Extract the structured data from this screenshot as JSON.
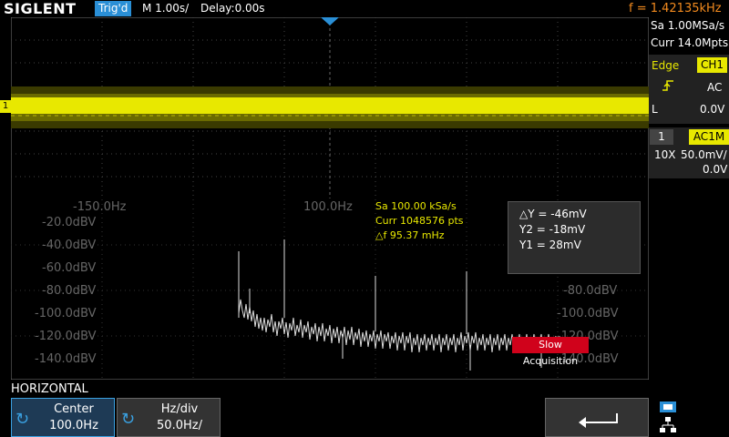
{
  "topbar": {
    "brand": "SIGLENT",
    "trigger_status": "Trig'd",
    "timebase": "M 1.00s/",
    "delay": "Delay:0.00s",
    "frequency": "f = 1.42135kHz"
  },
  "acquisition": {
    "sample_rate": "Sa 1.00MSa/s",
    "memory_depth": "Curr 14.0Mpts"
  },
  "trigger": {
    "type": "Edge",
    "source": "CH1",
    "slope_icon": "rising-edge-icon",
    "coupling": "AC",
    "level_label": "L",
    "level": "0.0V"
  },
  "channel1": {
    "number": "1",
    "coupling": "AC1M",
    "probe": "10X",
    "scale": "50.0mV/",
    "offset": "0.0V",
    "marker": "1",
    "color": "#e8e800"
  },
  "fft": {
    "freq_labels": [
      "-150.0Hz",
      "100.0Hz"
    ],
    "left_db_labels": [
      "-20.0dBV",
      "-40.0dBV",
      "-60.0dBV",
      "-80.0dBV",
      "-100.0dBV",
      "-120.0dBV",
      "-140.0dBV"
    ],
    "right_db_labels": [
      "-80.0dBV",
      "-100.0dBV",
      "-120.0dBV",
      "-140.0dBV"
    ],
    "info": {
      "sample_rate": "Sa 100.00 kSa/s",
      "points": "Curr 1048576 pts",
      "delta_f": "△f 95.37 mHz"
    },
    "slow_acquisition": "Slow Acquisition"
  },
  "cursors": {
    "delta_y": "△Y = -46mV",
    "y2": "Y2 = -18mV",
    "y1": "Y1 = 28mV"
  },
  "bottom": {
    "section_title": "HORIZONTAL",
    "center_label": "Center",
    "center_value": "100.0Hz",
    "hdiv_label": "Hz/div",
    "hdiv_value": "50.0Hz/",
    "back_icon": "return-arrow-icon",
    "usb_icon": "usb-icon",
    "network_icon": "network-icon"
  },
  "colors": {
    "accent_blue": "#2a8fd6",
    "trace_yellow": "#e8e800",
    "frequency_orange": "#f28a1e",
    "alert_red": "#d0021b"
  }
}
